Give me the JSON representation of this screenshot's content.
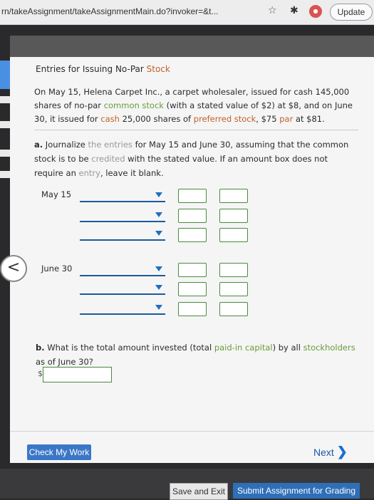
{
  "browser": {
    "url": "rn/takeAssignment/takeAssignmentMain.do?invoker=&t...",
    "update_label": "Update"
  },
  "problem": {
    "title_prefix": "Entries for Issuing No-Par ",
    "title_link": "Stock",
    "para1": {
      "t1": "On May 15, Helena Carpet Inc., a carpet wholesaler, issued for cash 145,000 shares of no-par ",
      "common_stock": "common stock",
      "t2": " (with a stated value of $2) at $8, and on June 30, it issued for ",
      "cash": "cash",
      "t3": " 25,000 shares of ",
      "preferred_stock": "preferred stock",
      "t4": ", $75 ",
      "par": "par",
      "t5": " at $81."
    },
    "part_a": {
      "label": "a.",
      "t1": " Journalize ",
      "the_entries": "the entries",
      "t2": " for May 15 and June 30, assuming that the common stock is to be ",
      "credited": "credited",
      "t3": " with the stated value. If an amount box does not require an ",
      "entry": "entry",
      "t4": ", leave it blank."
    },
    "dates": [
      "May 15",
      "June 30"
    ],
    "part_b": {
      "label": "b.",
      "t1": " What is the total amount invested (total ",
      "paid_in": "paid-in capital",
      "t2": ") by all ",
      "stockholders": "stockholders",
      "t3": " as of June 30?"
    },
    "dollar_sign": "$"
  },
  "footer": {
    "check_label": "Check My Work",
    "next_label": "Next",
    "save_label": "Save and Exit",
    "submit_label": "Submit Assignment for Grading"
  },
  "colors": {
    "accent": "#3a77c6",
    "link_orange": "#c0612b",
    "link_green": "#6a9b3a"
  }
}
